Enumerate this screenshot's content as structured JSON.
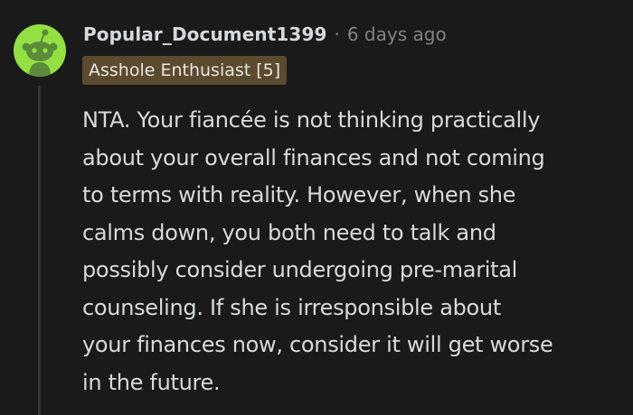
{
  "comment": {
    "username": "Popular_Document1399",
    "separator": "·",
    "timestamp": "6 days ago",
    "flair": "Asshole Enthusiast [5]",
    "avatar_icon": "snoo-avatar-icon",
    "colors": {
      "background": "#1a1a1b",
      "avatar_bg": "#94e044",
      "flair_bg": "#5c4a2f",
      "text": "#d7dadc",
      "meta": "#818384"
    },
    "body_lines": [
      "NTA. Your fiancée is not thinking practically",
      "about your overall finances and not coming",
      "to terms with reality. However, when she",
      "calms down, you both need to talk and",
      "possibly consider undergoing pre-marital",
      "counseling. If she is irresponsible about",
      "your finances now, consider it will get worse",
      "in the future."
    ]
  }
}
